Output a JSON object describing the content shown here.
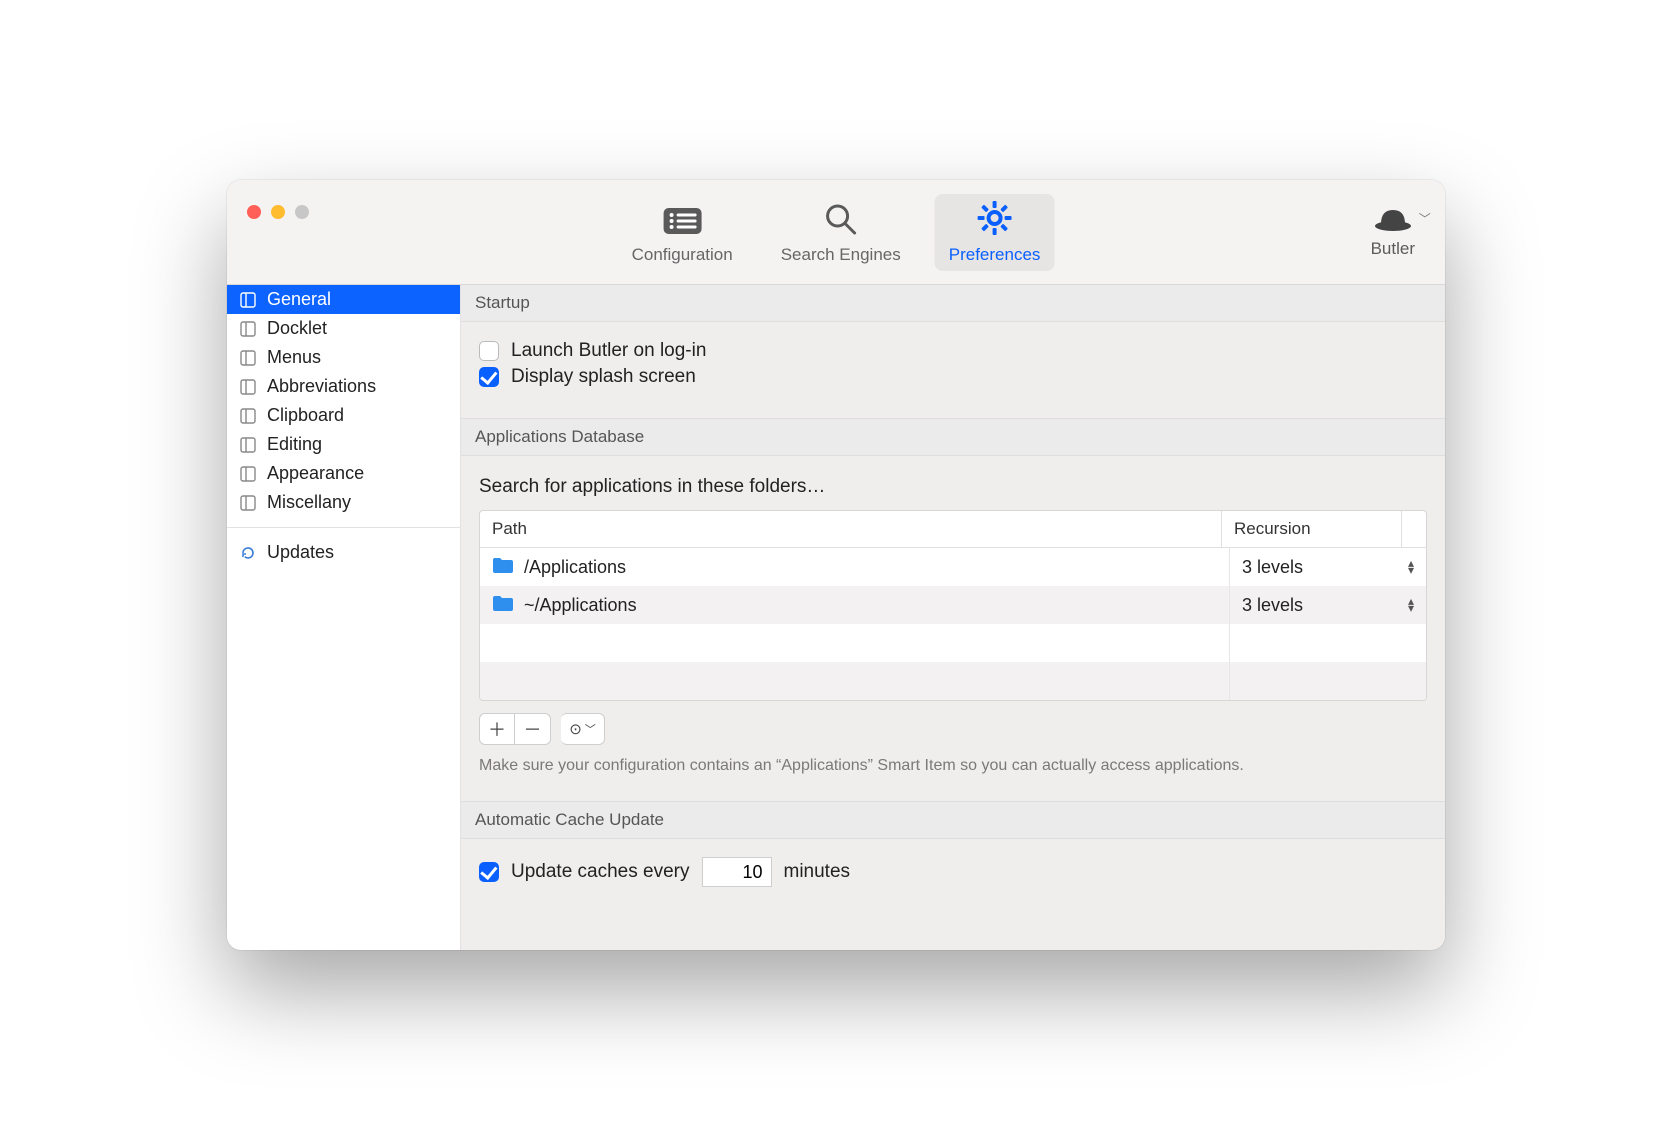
{
  "toolbar": {
    "tabs": [
      {
        "label": "Configuration"
      },
      {
        "label": "Search Engines"
      },
      {
        "label": "Preferences"
      }
    ],
    "active_tab": 2,
    "app_name": "Butler"
  },
  "sidebar": {
    "items": [
      {
        "label": "General"
      },
      {
        "label": "Docklet"
      },
      {
        "label": "Menus"
      },
      {
        "label": "Abbreviations"
      },
      {
        "label": "Clipboard"
      },
      {
        "label": "Editing"
      },
      {
        "label": "Appearance"
      },
      {
        "label": "Miscellany"
      }
    ],
    "selected": 0,
    "updates_label": "Updates"
  },
  "sections": {
    "startup": {
      "title": "Startup",
      "launch_label": "Launch Butler on log-in",
      "launch_checked": false,
      "splash_label": "Display splash screen",
      "splash_checked": true
    },
    "appdb": {
      "title": "Applications Database",
      "subhead": "Search for applications in these folders…",
      "columns": {
        "path": "Path",
        "recursion": "Recursion"
      },
      "rows": [
        {
          "path": "/Applications",
          "recursion": "3 levels"
        },
        {
          "path": "~/Applications",
          "recursion": "3 levels"
        }
      ],
      "help": "Make sure your configuration contains an “Applications” Smart Item so you can actually access applications."
    },
    "cache": {
      "title": "Automatic Cache Update",
      "update_label": "Update caches every",
      "value": "10",
      "unit": "minutes",
      "checked": true
    }
  }
}
